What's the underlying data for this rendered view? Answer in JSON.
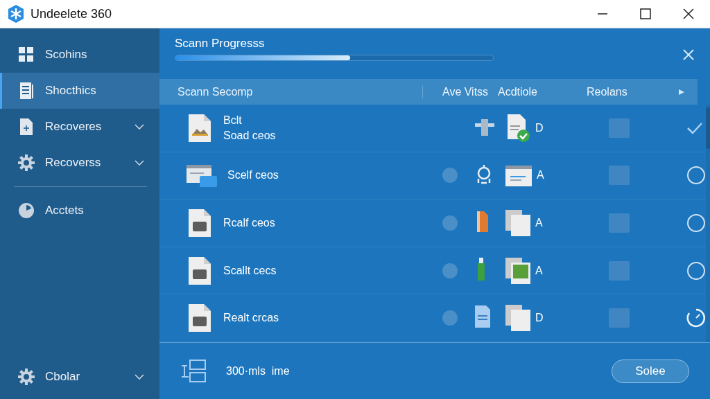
{
  "window": {
    "title": "Undeelete 360"
  },
  "sidebar": {
    "items": [
      {
        "label": "Scohins",
        "selected": false,
        "expandable": false
      },
      {
        "label": "Shocthics",
        "selected": true,
        "expandable": false
      },
      {
        "label": "Recoveres",
        "selected": false,
        "expandable": true
      },
      {
        "label": "Recoverss",
        "selected": false,
        "expandable": true
      },
      {
        "label": "Acctets",
        "selected": false,
        "expandable": false
      }
    ],
    "bottom_item": {
      "label": "Cbolar",
      "expandable": true
    }
  },
  "progress": {
    "title": "Scann Progresss",
    "level": 0.55
  },
  "table": {
    "columns": [
      "Scann Secomp",
      "Ave Vitss",
      "Acdtiole",
      "Reolans"
    ],
    "rows": [
      {
        "kind": "done",
        "name": "Bclt",
        "name_2": "Soad ceos",
        "dot": false,
        "drive": "D",
        "checked": false
      },
      {
        "kind": "pending",
        "name": "Scelf ceos",
        "dot": true,
        "drive": "A",
        "checked": false
      },
      {
        "kind": "pending",
        "name": "Rcalf ceos",
        "dot": true,
        "drive": "A",
        "checked": false
      },
      {
        "kind": "pending",
        "name": "Scallt cecs",
        "dot": true,
        "drive": "A",
        "checked": false
      },
      {
        "kind": "loading",
        "name": "Realt crcas",
        "dot": true,
        "drive": "D",
        "checked": false
      }
    ]
  },
  "footer": {
    "info": "300·mls  ime",
    "button": "Solee"
  }
}
